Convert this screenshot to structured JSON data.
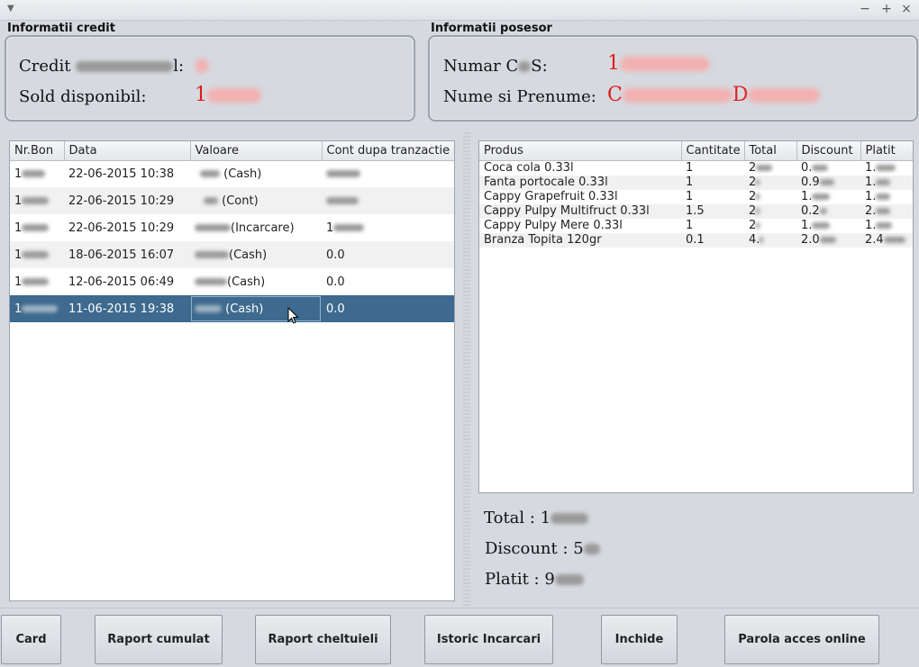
{
  "credit_section": {
    "title": "Informatii credit",
    "credit_label": "Credit",
    "credit_label_suffix": "l:",
    "sold_label": "Sold disponibil:",
    "sold_value_prefix": "1"
  },
  "owner_section": {
    "title": "Informatii posesor",
    "numar_label_start": "Numar C",
    "numar_label_end": "S:",
    "numar_value_prefix": "1",
    "nume_label": "Nume si Prenume:",
    "nume_value_prefix": "C",
    "nume_value_middle": "D"
  },
  "transactions": {
    "columns": [
      "Nr.Bon",
      "Data",
      "Valoare",
      "Cont dupa tranzactie"
    ],
    "rows": [
      {
        "bon": "1",
        "data": "22-06-2015 10:38",
        "valoare": "(Cash)",
        "cont": ""
      },
      {
        "bon": "1",
        "data": "22-06-2015 10:29",
        "valoare": "(Cont)",
        "cont": ""
      },
      {
        "bon": "1",
        "data": "22-06-2015 10:29",
        "valoare": "(Incarcare)",
        "cont": "1"
      },
      {
        "bon": "1",
        "data": "18-06-2015 16:07",
        "valoare": "(Cash)",
        "cont": "0.0"
      },
      {
        "bon": "1",
        "data": "12-06-2015 06:49",
        "valoare": "(Cash)",
        "cont": "0.0"
      },
      {
        "bon": "1",
        "data": "11-06-2015 19:38",
        "valoare": "(Cash)",
        "cont": "0.0"
      }
    ]
  },
  "products": {
    "columns": [
      "Produs",
      "Cantitate",
      "Total",
      "Discount",
      "Platit"
    ],
    "rows": [
      {
        "produs": "Coca cola 0.33l",
        "cantitate": "1",
        "total": "2",
        "discount": "0.",
        "platit": "1."
      },
      {
        "produs": "Fanta portocale 0.33l",
        "cantitate": "1",
        "total": "2",
        "discount": "0.9",
        "platit": "1."
      },
      {
        "produs": "Cappy Grapefruit 0.33l",
        "cantitate": "1",
        "total": "2",
        "discount": "1.",
        "platit": "1."
      },
      {
        "produs": "Cappy Pulpy Multifruct 0.33l",
        "cantitate": "1.5",
        "total": "2",
        "discount": "0.2",
        "platit": "2."
      },
      {
        "produs": "Cappy Pulpy Mere 0.33l",
        "cantitate": "1",
        "total": "2",
        "discount": "1.",
        "platit": "1."
      },
      {
        "produs": "Branza Topita 120gr",
        "cantitate": "0.1",
        "total": "4.",
        "discount": "2.0",
        "platit": "2.4"
      }
    ]
  },
  "totals": {
    "total_label": "Total :",
    "total_value_prefix": "1",
    "discount_label": "Discount :",
    "discount_value_prefix": "5",
    "platit_label": "Platit :",
    "platit_value_prefix": "9"
  },
  "buttons": {
    "card": "Card",
    "raport_cumulat": "Raport cumulat",
    "raport_cheltuieli": "Raport cheltuieli",
    "istoric_incarcari": "Istoric Incarcari",
    "inchide": "Inchide",
    "parola": "Parola acces online"
  },
  "window_controls": {
    "minimize": "−",
    "maximize": "+",
    "close": "×",
    "menu": "▼"
  }
}
